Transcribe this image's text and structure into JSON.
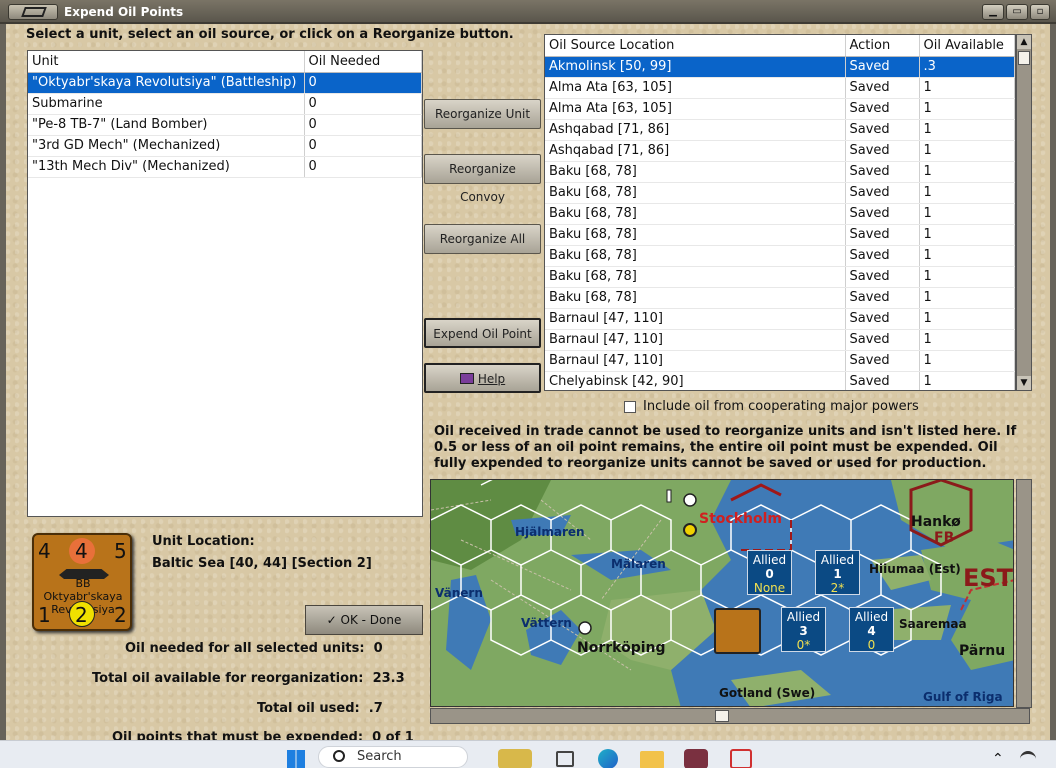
{
  "window": {
    "title": "Expend Oil Points"
  },
  "instructions": "Select a unit, select an oil source, or click on a Reorganize button.",
  "units_table": {
    "headers": [
      "Unit",
      "Oil Needed"
    ],
    "rows": [
      {
        "unit": "\"Oktyabr'skaya Revolutsiya\" (Battleship)",
        "oil": "0"
      },
      {
        "unit": "Submarine",
        "oil": "0"
      },
      {
        "unit": "\"Pe-8 TB-7\" (Land Bomber)",
        "oil": "0"
      },
      {
        "unit": "\"3rd GD Mech\" (Mechanized)",
        "oil": "0"
      },
      {
        "unit": "\"13th Mech Div\" (Mechanized)",
        "oil": "0"
      }
    ]
  },
  "buttons": {
    "reorganize_unit": "Reorganize Unit",
    "reorganize_convoy": "Reorganize Convoy",
    "reorganize_all": "Reorganize All",
    "expend_oil_point": "Expend Oil Point",
    "help": "Help",
    "ok_done": "OK - Done"
  },
  "oil_table": {
    "headers": [
      "Oil Source Location",
      "Action",
      "Oil Available"
    ],
    "rows": [
      {
        "loc": "Akmolinsk [50, 99]",
        "action": "Saved",
        "avail": ".3"
      },
      {
        "loc": "Alma Ata [63, 105]",
        "action": "Saved",
        "avail": "1"
      },
      {
        "loc": "Alma Ata [63, 105]",
        "action": "Saved",
        "avail": "1"
      },
      {
        "loc": "Ashqabad [71, 86]",
        "action": "Saved",
        "avail": "1"
      },
      {
        "loc": "Ashqabad [71, 86]",
        "action": "Saved",
        "avail": "1"
      },
      {
        "loc": "Baku [68, 78]",
        "action": "Saved",
        "avail": "1"
      },
      {
        "loc": "Baku [68, 78]",
        "action": "Saved",
        "avail": "1"
      },
      {
        "loc": "Baku [68, 78]",
        "action": "Saved",
        "avail": "1"
      },
      {
        "loc": "Baku [68, 78]",
        "action": "Saved",
        "avail": "1"
      },
      {
        "loc": "Baku [68, 78]",
        "action": "Saved",
        "avail": "1"
      },
      {
        "loc": "Baku [68, 78]",
        "action": "Saved",
        "avail": "1"
      },
      {
        "loc": "Baku [68, 78]",
        "action": "Saved",
        "avail": "1"
      },
      {
        "loc": "Barnaul [47, 110]",
        "action": "Saved",
        "avail": "1"
      },
      {
        "loc": "Barnaul [47, 110]",
        "action": "Saved",
        "avail": "1"
      },
      {
        "loc": "Barnaul [47, 110]",
        "action": "Saved",
        "avail": "1"
      },
      {
        "loc": "Chelyabinsk [42, 90]",
        "action": "Saved",
        "avail": "1"
      }
    ]
  },
  "include_coop_label": "Include oil from cooperating major powers",
  "note": "Oil received in trade cannot be used to reorganize units and isn't listed here.  If 0.5 or less of an oil point remains, the entire oil point must be expended.   Oil fully expended to reorganize units cannot be saved or used for production.",
  "unit_location": {
    "label": "Unit Location:",
    "value": "Baltic Sea [40, 44] [Section 2]"
  },
  "counter": {
    "tl": "4",
    "tm": "4",
    "tr": "5",
    "name": "BB Oktyabr'skaya Revolutsiya",
    "bl": "1",
    "bm": "2",
    "br": "2"
  },
  "stats": [
    {
      "label": "Oil needed for all selected units:",
      "value": "0"
    },
    {
      "label": "Total oil available for reorganization:",
      "value": "23.3"
    },
    {
      "label": "Total oil used:",
      "value": ".7"
    },
    {
      "label": "Oil points that must be expended:",
      "value": "0 of 1"
    }
  ],
  "map": {
    "labels": {
      "stockholm": "Stockholm",
      "hjalmaren": "Hjälmaren",
      "malaren": "Mälaren",
      "vanern": "Vänern",
      "vattern": "Vättern",
      "norrkoping": "Norrköping",
      "gotland": "Gotland (Swe)",
      "hanko": "Hankø",
      "fb": "FB",
      "hiiumaa": "Hiiumaa (Est)",
      "est": "EST",
      "saaremaa": "Saaremaa",
      "parnu": "Pärnu",
      "gulf": "Gulf of Riga"
    },
    "sea_boxes": [
      {
        "title": "Allied",
        "num": "0",
        "sub": "None"
      },
      {
        "title": "Allied",
        "num": "1",
        "sub": "2*"
      },
      {
        "title": "Allied",
        "num": "3",
        "sub": "0*"
      },
      {
        "title": "Allied",
        "num": "4",
        "sub": "0"
      }
    ]
  },
  "taskbar": {
    "search": "Search"
  }
}
